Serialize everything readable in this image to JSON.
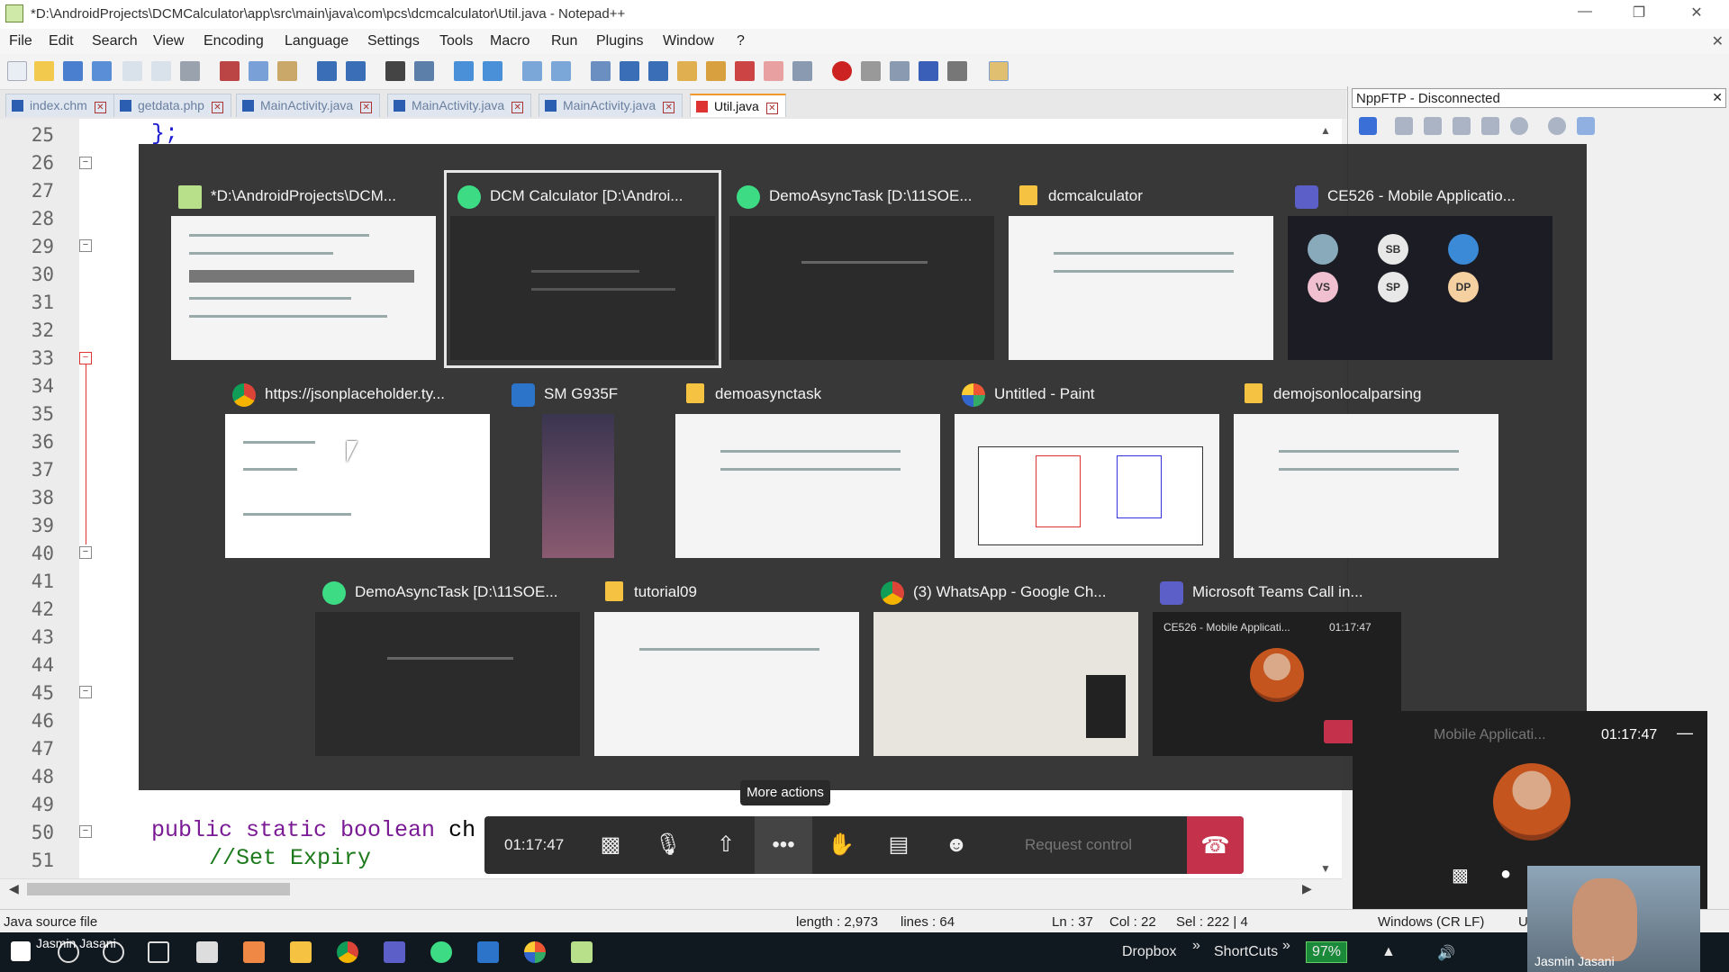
{
  "window": {
    "title": "*D:\\AndroidProjects\\DCMCalculator\\app\\src\\main\\java\\com\\pcs\\dcmcalculator\\Util.java - Notepad++"
  },
  "menu": [
    "File",
    "Edit",
    "Search",
    "View",
    "Encoding",
    "Language",
    "Settings",
    "Tools",
    "Macro",
    "Run",
    "Plugins",
    "Window",
    "?"
  ],
  "tabs": [
    {
      "label": "index.chm",
      "active": false
    },
    {
      "label": "getdata.php",
      "active": false
    },
    {
      "label": "MainActivity.java",
      "active": false
    },
    {
      "label": "MainActivity.java",
      "active": false
    },
    {
      "label": "MainActivity.java",
      "active": false
    },
    {
      "label": "Util.java",
      "active": true
    }
  ],
  "ftp_panel": {
    "title": "NppFTP - Disconnected"
  },
  "editor": {
    "line_numbers": [
      "25",
      "26",
      "27",
      "28",
      "29",
      "30",
      "31",
      "32",
      "33",
      "34",
      "35",
      "36",
      "37",
      "38",
      "39",
      "40",
      "41",
      "42",
      "43",
      "44",
      "45",
      "46",
      "47",
      "48",
      "49",
      "50",
      "51"
    ],
    "code_line_25": "};",
    "code_line_50_kw": "public static boolean",
    "code_line_50_rest": " ch",
    "code_line_51": "//Set Expiry"
  },
  "statusbar": {
    "file_type": "Java source file",
    "length": "length : 2,973",
    "lines": "lines : 64",
    "ln": "Ln : 37",
    "col": "Col : 22",
    "sel": "Sel : 222 | 4",
    "eol": "Windows (CR LF)",
    "enc": "U"
  },
  "switcher": {
    "windows": [
      {
        "label": "*D:\\AndroidProjects\\DCM...",
        "icon": "notepad-icon"
      },
      {
        "label": "DCM Calculator [D:\\Androi...",
        "icon": "android-studio-icon",
        "selected": true
      },
      {
        "label": "DemoAsyncTask [D:\\11SOE...",
        "icon": "android-studio-icon"
      },
      {
        "label": "dcmcalculator",
        "icon": "folder-icon"
      },
      {
        "label": "CE526 - Mobile Applicatio...",
        "icon": "teams-icon"
      },
      {
        "label": "https://jsonplaceholder.ty...",
        "icon": "chrome-icon"
      },
      {
        "label": "SM G935F",
        "icon": "phone-mirror-icon"
      },
      {
        "label": "demoasynctask",
        "icon": "folder-icon"
      },
      {
        "label": "Untitled - Paint",
        "icon": "paint-icon"
      },
      {
        "label": "demojsonlocalparsing",
        "icon": "folder-icon"
      },
      {
        "label": "DemoAsyncTask [D:\\11SOE...",
        "icon": "android-studio-icon"
      },
      {
        "label": "tutorial09",
        "icon": "folder-icon"
      },
      {
        "label": "(3) WhatsApp - Google Ch...",
        "icon": "chrome-icon"
      },
      {
        "label": "Microsoft Teams Call in...",
        "icon": "teams-icon"
      }
    ],
    "teams_avatars": [
      "SB",
      "VS",
      "SP",
      "DP"
    ],
    "teams_call_thumb": {
      "title": "CE526 - Mobile Applicati...",
      "time": "01:17:47"
    }
  },
  "callbar": {
    "tooltip": "More actions",
    "timer": "01:17:47",
    "request_control": "Request control"
  },
  "meeting_window": {
    "title": "Mobile Applicati...",
    "time": "01:17:47"
  },
  "taskbar": {
    "user": "Jasmin Jasani",
    "tray_dropbox": "Dropbox",
    "tray_shortcuts": "ShortCuts",
    "battery": "97%",
    "chevron": "»"
  },
  "camera": {
    "name": "Jasmin Jasani"
  }
}
